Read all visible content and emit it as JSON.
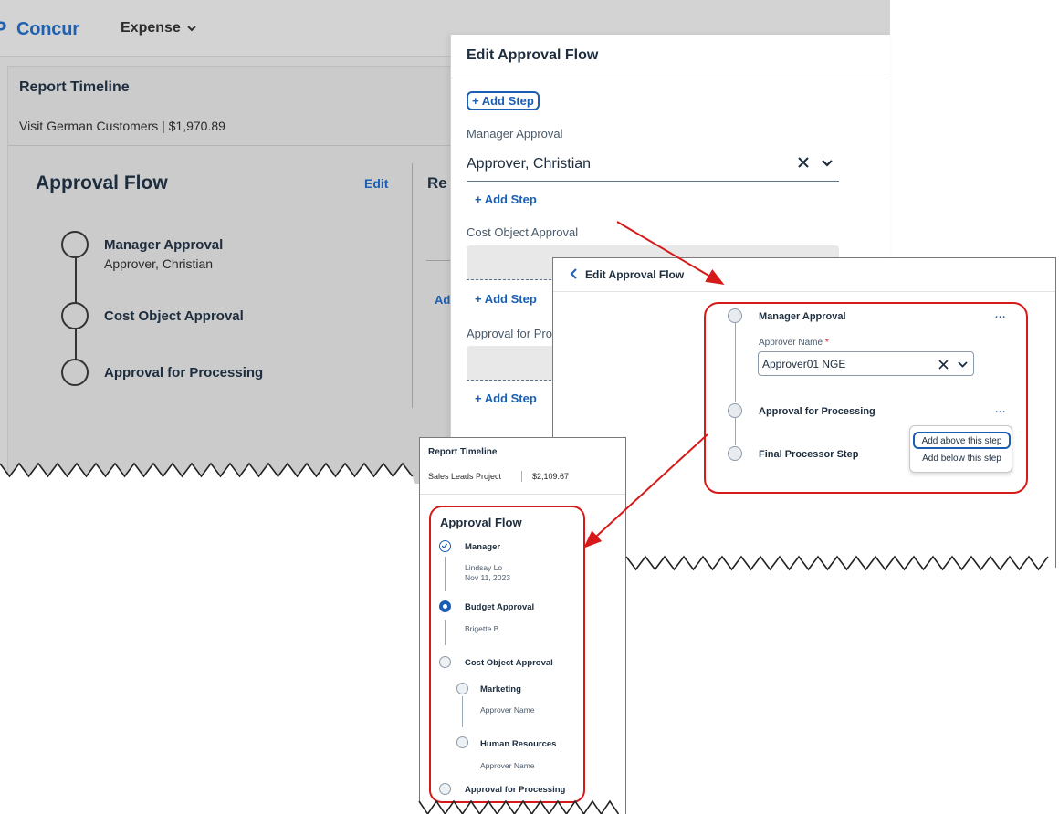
{
  "desktop": {
    "brand": "Concur",
    "menu_label": "Expense",
    "report_title": "Report Timeline",
    "report_subtitle": "Visit German Customers | $1,970.89",
    "approval_flow_title": "Approval Flow",
    "edit_label": "Edit",
    "clipped_heading": "Re",
    "clipped_link": "Ad",
    "steps": [
      {
        "label": "Manager Approval",
        "sub": "Approver, Christian"
      },
      {
        "label": "Cost Object Approval",
        "sub": ""
      },
      {
        "label": "Approval for Processing",
        "sub": ""
      }
    ]
  },
  "edit_modal": {
    "title": "Edit Approval Flow",
    "add_step_label": "+ Add Step",
    "sections": [
      {
        "label": "Manager Approval",
        "value": "Approver, Christian"
      },
      {
        "label": "Cost Object Approval",
        "value": ""
      },
      {
        "label": "Approval for Pro",
        "value": ""
      }
    ]
  },
  "edit_panel": {
    "back_title": "Edit Approval Flow",
    "steps": [
      "Manager Approval",
      "Approval for Processing",
      "Final Processor Step"
    ],
    "field_label": "Approver Name",
    "required_mark": "*",
    "field_value": "Approver01 NGE",
    "more_label": "...",
    "menu_items": [
      "Add above this step",
      "Add below this step"
    ]
  },
  "mobile": {
    "title": "Report Timeline",
    "report_name": "Sales Leads Project",
    "report_amount": "$2,109.67",
    "approval_flow_title": "Approval Flow",
    "steps": [
      {
        "label": "Manager",
        "status": "done",
        "lines": [
          "Lindsay Lo",
          "Nov 11, 2023"
        ]
      },
      {
        "label": "Budget Approval",
        "status": "current",
        "lines": [
          "Brigette B"
        ]
      },
      {
        "label": "Cost Object Approval",
        "status": "pending",
        "lines": []
      },
      {
        "label": "Marketing",
        "status": "pending",
        "lines": [
          "Approver Name"
        ]
      },
      {
        "label": "Human Resources",
        "status": "pending",
        "lines": [
          "Approver Name"
        ]
      },
      {
        "label": "Approval for Processing",
        "status": "pending",
        "lines": []
      }
    ]
  },
  "colors": {
    "accent": "#1a5fb4",
    "annotation_red": "#d61a1a",
    "brand_blue": "#1e61b0"
  },
  "icons": [
    "chevron-down-icon",
    "clear-icon",
    "back-chevron-icon",
    "check-icon"
  ]
}
